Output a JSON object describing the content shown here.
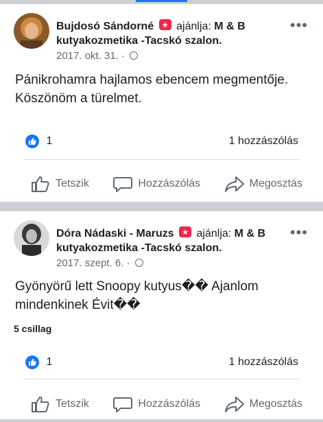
{
  "posts": [
    {
      "author": "Bujdosó Sándorné",
      "recommends": "ajánlja:",
      "page": "M & B kutyakozmetika -Tacskó szalon.",
      "date": "2017. okt. 31.",
      "date_sep": "·",
      "text": "Pánikrohamra hajlamos ebencem megmentője. Köszönöm a türelmet.",
      "rating": "",
      "like_count": "1",
      "comment_count": "1 hozzászólás"
    },
    {
      "author": "Dóra Nádaski - Maruzs",
      "recommends": "ajánlja:",
      "page": "M & B kutyakozmetika -Tacskó szalon.",
      "date": "2017. szept. 6.",
      "date_sep": "·",
      "text": "Gyönyörű lett Snoopy kutyus�� Ajanlom mindenkinek Évit��",
      "rating": "5 csillag",
      "like_count": "1",
      "comment_count": "1 hozzászólás"
    }
  ],
  "actions": {
    "like": "Tetszik",
    "comment": "Hozzászólás",
    "share": "Megosztás"
  },
  "more_label": "•••",
  "colors": {
    "brand_blue": "#1877f2",
    "recommend_red": "#f02849",
    "divider_gray": "#cdd0d4"
  },
  "icons": [
    "recommend-icon",
    "globe-icon",
    "more-icon",
    "like-reaction-icon",
    "thumbs-up-icon",
    "comment-icon",
    "share-icon"
  ]
}
